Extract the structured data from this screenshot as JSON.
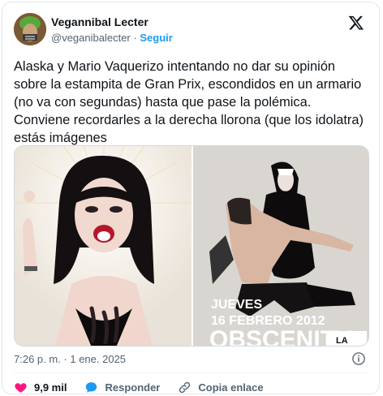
{
  "author": {
    "display_name": "Vegannibal Lecter",
    "handle": "@veganibalecter",
    "separator": "·",
    "follow_label": "Seguir"
  },
  "icons": {
    "brand": "x-logo-icon",
    "info": "info-icon",
    "like": "heart-icon",
    "reply": "speech-bubble-icon",
    "copy": "link-icon"
  },
  "tweet": {
    "text": "Alaska y Mario Vaquerizo intentando no dar su opinión sobre la estampita de Gran Prix, escondidos en un armario (no va con segundas) hasta que pase la polémica. Conviene recordarles a la derecha llorona (que los idolatra) estás imágenes",
    "timestamp": "7:26 p. m. · 1 ene. 2025"
  },
  "media": {
    "right_caption_line1": "JUEVES",
    "right_caption_line2": "16 FEBRERO 2012",
    "right_caption_line3": "OBSCENITY",
    "right_caption_tag": "LA"
  },
  "actions": {
    "like_count": "9,9 mil",
    "reply_label": "Responder",
    "copy_label": "Copia enlace"
  },
  "colors": {
    "accent": "#1d9bf0",
    "like": "#f91880",
    "muted": "#536471",
    "text": "#0f1419"
  }
}
